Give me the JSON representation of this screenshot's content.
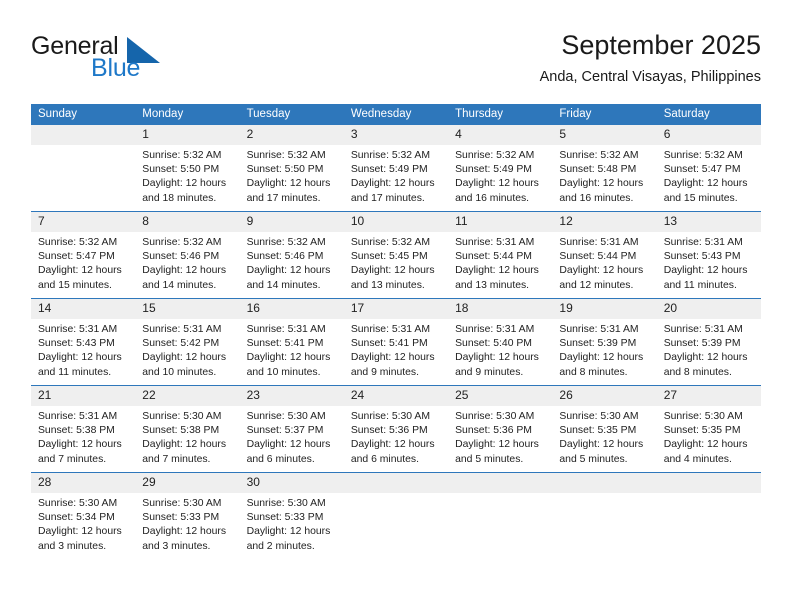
{
  "brand": {
    "word_one": "General",
    "word_two": "Blue",
    "triangle_icon": "triangle-icon",
    "colors": {
      "blue": "#1e78c8",
      "triangle": "#1565ab",
      "dark": "#1a1a1a"
    }
  },
  "header": {
    "title": "September 2025",
    "subtitle": "Anda, Central Visayas, Philippines"
  },
  "calendar": {
    "header_bg": "#2e77bb",
    "daynum_bg": "#efefef",
    "weekday_headers": [
      "Sunday",
      "Monday",
      "Tuesday",
      "Wednesday",
      "Thursday",
      "Friday",
      "Saturday"
    ],
    "weeks": [
      [
        {
          "day": "",
          "sunrise": "",
          "sunset": "",
          "daylight_line1": "",
          "daylight_line2": "",
          "blank": true
        },
        {
          "day": "1",
          "sunrise": "Sunrise: 5:32 AM",
          "sunset": "Sunset: 5:50 PM",
          "daylight_line1": "Daylight: 12 hours",
          "daylight_line2": "and 18 minutes.",
          "blank": false
        },
        {
          "day": "2",
          "sunrise": "Sunrise: 5:32 AM",
          "sunset": "Sunset: 5:50 PM",
          "daylight_line1": "Daylight: 12 hours",
          "daylight_line2": "and 17 minutes.",
          "blank": false
        },
        {
          "day": "3",
          "sunrise": "Sunrise: 5:32 AM",
          "sunset": "Sunset: 5:49 PM",
          "daylight_line1": "Daylight: 12 hours",
          "daylight_line2": "and 17 minutes.",
          "blank": false
        },
        {
          "day": "4",
          "sunrise": "Sunrise: 5:32 AM",
          "sunset": "Sunset: 5:49 PM",
          "daylight_line1": "Daylight: 12 hours",
          "daylight_line2": "and 16 minutes.",
          "blank": false
        },
        {
          "day": "5",
          "sunrise": "Sunrise: 5:32 AM",
          "sunset": "Sunset: 5:48 PM",
          "daylight_line1": "Daylight: 12 hours",
          "daylight_line2": "and 16 minutes.",
          "blank": false
        },
        {
          "day": "6",
          "sunrise": "Sunrise: 5:32 AM",
          "sunset": "Sunset: 5:47 PM",
          "daylight_line1": "Daylight: 12 hours",
          "daylight_line2": "and 15 minutes.",
          "blank": false
        }
      ],
      [
        {
          "day": "7",
          "sunrise": "Sunrise: 5:32 AM",
          "sunset": "Sunset: 5:47 PM",
          "daylight_line1": "Daylight: 12 hours",
          "daylight_line2": "and 15 minutes.",
          "blank": false
        },
        {
          "day": "8",
          "sunrise": "Sunrise: 5:32 AM",
          "sunset": "Sunset: 5:46 PM",
          "daylight_line1": "Daylight: 12 hours",
          "daylight_line2": "and 14 minutes.",
          "blank": false
        },
        {
          "day": "9",
          "sunrise": "Sunrise: 5:32 AM",
          "sunset": "Sunset: 5:46 PM",
          "daylight_line1": "Daylight: 12 hours",
          "daylight_line2": "and 14 minutes.",
          "blank": false
        },
        {
          "day": "10",
          "sunrise": "Sunrise: 5:32 AM",
          "sunset": "Sunset: 5:45 PM",
          "daylight_line1": "Daylight: 12 hours",
          "daylight_line2": "and 13 minutes.",
          "blank": false
        },
        {
          "day": "11",
          "sunrise": "Sunrise: 5:31 AM",
          "sunset": "Sunset: 5:44 PM",
          "daylight_line1": "Daylight: 12 hours",
          "daylight_line2": "and 13 minutes.",
          "blank": false
        },
        {
          "day": "12",
          "sunrise": "Sunrise: 5:31 AM",
          "sunset": "Sunset: 5:44 PM",
          "daylight_line1": "Daylight: 12 hours",
          "daylight_line2": "and 12 minutes.",
          "blank": false
        },
        {
          "day": "13",
          "sunrise": "Sunrise: 5:31 AM",
          "sunset": "Sunset: 5:43 PM",
          "daylight_line1": "Daylight: 12 hours",
          "daylight_line2": "and 11 minutes.",
          "blank": false
        }
      ],
      [
        {
          "day": "14",
          "sunrise": "Sunrise: 5:31 AM",
          "sunset": "Sunset: 5:43 PM",
          "daylight_line1": "Daylight: 12 hours",
          "daylight_line2": "and 11 minutes.",
          "blank": false
        },
        {
          "day": "15",
          "sunrise": "Sunrise: 5:31 AM",
          "sunset": "Sunset: 5:42 PM",
          "daylight_line1": "Daylight: 12 hours",
          "daylight_line2": "and 10 minutes.",
          "blank": false
        },
        {
          "day": "16",
          "sunrise": "Sunrise: 5:31 AM",
          "sunset": "Sunset: 5:41 PM",
          "daylight_line1": "Daylight: 12 hours",
          "daylight_line2": "and 10 minutes.",
          "blank": false
        },
        {
          "day": "17",
          "sunrise": "Sunrise: 5:31 AM",
          "sunset": "Sunset: 5:41 PM",
          "daylight_line1": "Daylight: 12 hours",
          "daylight_line2": "and 9 minutes.",
          "blank": false
        },
        {
          "day": "18",
          "sunrise": "Sunrise: 5:31 AM",
          "sunset": "Sunset: 5:40 PM",
          "daylight_line1": "Daylight: 12 hours",
          "daylight_line2": "and 9 minutes.",
          "blank": false
        },
        {
          "day": "19",
          "sunrise": "Sunrise: 5:31 AM",
          "sunset": "Sunset: 5:39 PM",
          "daylight_line1": "Daylight: 12 hours",
          "daylight_line2": "and 8 minutes.",
          "blank": false
        },
        {
          "day": "20",
          "sunrise": "Sunrise: 5:31 AM",
          "sunset": "Sunset: 5:39 PM",
          "daylight_line1": "Daylight: 12 hours",
          "daylight_line2": "and 8 minutes.",
          "blank": false
        }
      ],
      [
        {
          "day": "21",
          "sunrise": "Sunrise: 5:31 AM",
          "sunset": "Sunset: 5:38 PM",
          "daylight_line1": "Daylight: 12 hours",
          "daylight_line2": "and 7 minutes.",
          "blank": false
        },
        {
          "day": "22",
          "sunrise": "Sunrise: 5:30 AM",
          "sunset": "Sunset: 5:38 PM",
          "daylight_line1": "Daylight: 12 hours",
          "daylight_line2": "and 7 minutes.",
          "blank": false
        },
        {
          "day": "23",
          "sunrise": "Sunrise: 5:30 AM",
          "sunset": "Sunset: 5:37 PM",
          "daylight_line1": "Daylight: 12 hours",
          "daylight_line2": "and 6 minutes.",
          "blank": false
        },
        {
          "day": "24",
          "sunrise": "Sunrise: 5:30 AM",
          "sunset": "Sunset: 5:36 PM",
          "daylight_line1": "Daylight: 12 hours",
          "daylight_line2": "and 6 minutes.",
          "blank": false
        },
        {
          "day": "25",
          "sunrise": "Sunrise: 5:30 AM",
          "sunset": "Sunset: 5:36 PM",
          "daylight_line1": "Daylight: 12 hours",
          "daylight_line2": "and 5 minutes.",
          "blank": false
        },
        {
          "day": "26",
          "sunrise": "Sunrise: 5:30 AM",
          "sunset": "Sunset: 5:35 PM",
          "daylight_line1": "Daylight: 12 hours",
          "daylight_line2": "and 5 minutes.",
          "blank": false
        },
        {
          "day": "27",
          "sunrise": "Sunrise: 5:30 AM",
          "sunset": "Sunset: 5:35 PM",
          "daylight_line1": "Daylight: 12 hours",
          "daylight_line2": "and 4 minutes.",
          "blank": false
        }
      ],
      [
        {
          "day": "28",
          "sunrise": "Sunrise: 5:30 AM",
          "sunset": "Sunset: 5:34 PM",
          "daylight_line1": "Daylight: 12 hours",
          "daylight_line2": "and 3 minutes.",
          "blank": false
        },
        {
          "day": "29",
          "sunrise": "Sunrise: 5:30 AM",
          "sunset": "Sunset: 5:33 PM",
          "daylight_line1": "Daylight: 12 hours",
          "daylight_line2": "and 3 minutes.",
          "blank": false
        },
        {
          "day": "30",
          "sunrise": "Sunrise: 5:30 AM",
          "sunset": "Sunset: 5:33 PM",
          "daylight_line1": "Daylight: 12 hours",
          "daylight_line2": "and 2 minutes.",
          "blank": false
        },
        {
          "day": "",
          "sunrise": "",
          "sunset": "",
          "daylight_line1": "",
          "daylight_line2": "",
          "blank": true
        },
        {
          "day": "",
          "sunrise": "",
          "sunset": "",
          "daylight_line1": "",
          "daylight_line2": "",
          "blank": true
        },
        {
          "day": "",
          "sunrise": "",
          "sunset": "",
          "daylight_line1": "",
          "daylight_line2": "",
          "blank": true
        },
        {
          "day": "",
          "sunrise": "",
          "sunset": "",
          "daylight_line1": "",
          "daylight_line2": "",
          "blank": true
        }
      ]
    ]
  }
}
